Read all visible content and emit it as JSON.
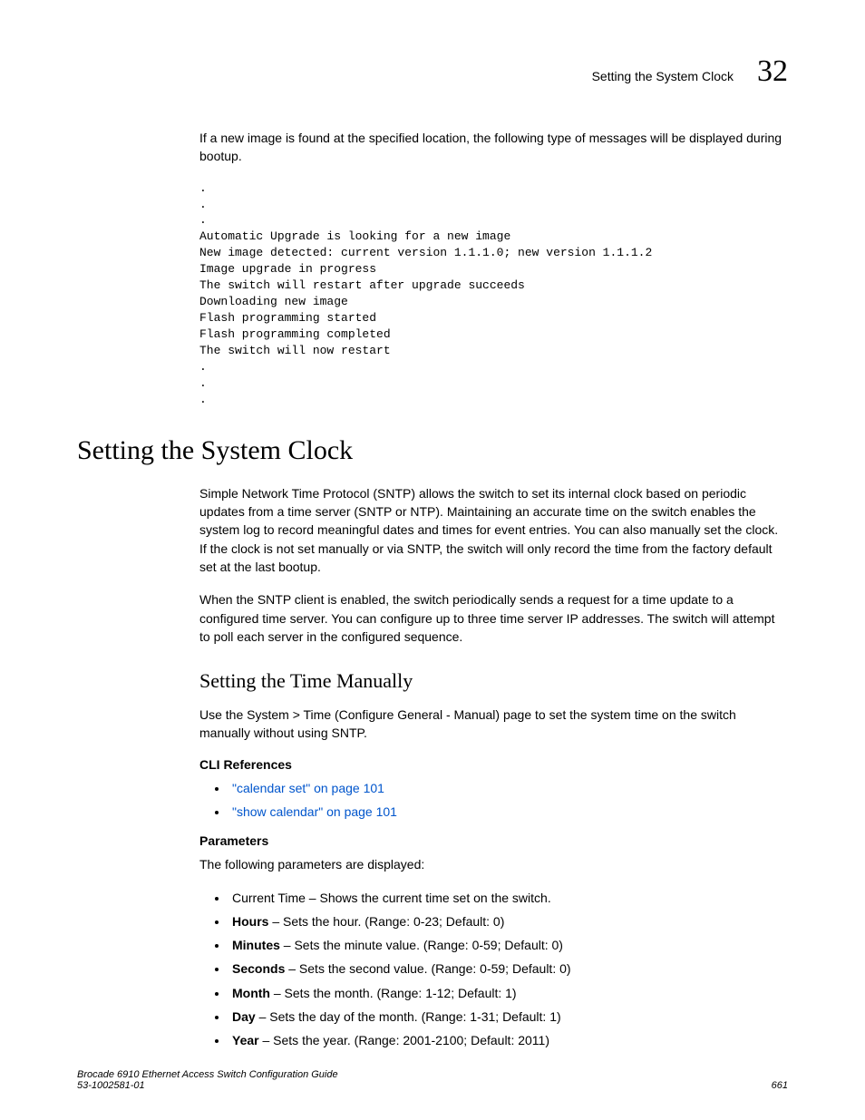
{
  "header": {
    "section": "Setting the System Clock",
    "chapter": "32"
  },
  "intro_para": "If a new image is found at the specified location, the following type of messages will be displayed during bootup.",
  "code_block": ".\n.\n.\nAutomatic Upgrade is looking for a new image\nNew image detected: current version 1.1.1.0; new version 1.1.1.2\nImage upgrade in progress\nThe switch will restart after upgrade succeeds\nDownloading new image\nFlash programming started\nFlash programming completed\nThe switch will now restart\n.\n.\n.",
  "h1": "Setting the System Clock",
  "p1": "Simple Network Time Protocol (SNTP) allows the switch to set its internal clock based on periodic updates from a time server (SNTP or NTP). Maintaining an accurate time on the switch enables the system log to record meaningful dates and times for event entries. You can also manually set the clock. If the clock is not set manually or via SNTP, the switch will only record the time from the factory default set at the last bootup.",
  "p2": "When the SNTP client is enabled, the switch periodically sends a request for a time update to a configured time server. You can configure up to three time server IP addresses. The switch will attempt to poll each server in the configured sequence.",
  "h2": "Setting the Time Manually",
  "p3": "Use the System > Time (Configure General - Manual) page to set the system time on the switch manually without using SNTP.",
  "cli_heading": "CLI References",
  "cli_links": [
    "\"calendar set\" on page 101",
    "\"show calendar\" on page 101"
  ],
  "params_heading": "Parameters",
  "params_intro": "The following parameters are displayed:",
  "params": [
    {
      "term": "",
      "desc": "Current Time – Shows the current time set on the switch."
    },
    {
      "term": "Hours",
      "desc": " – Sets the hour. (Range: 0-23; Default: 0)"
    },
    {
      "term": "Minutes",
      "desc": " – Sets the minute value. (Range: 0-59; Default: 0)"
    },
    {
      "term": "Seconds",
      "desc": " – Sets the second value. (Range: 0-59; Default: 0)"
    },
    {
      "term": "Month",
      "desc": " – Sets the month. (Range: 1-12; Default: 1)"
    },
    {
      "term": "Day",
      "desc": " – Sets the day of the month. (Range: 1-31; Default: 1)"
    },
    {
      "term": "Year",
      "desc": " – Sets the year. (Range: 2001-2100; Default: 2011)"
    }
  ],
  "footer": {
    "title": "Brocade 6910 Ethernet Access Switch Configuration Guide",
    "docnum": "53-1002581-01",
    "page": "661"
  }
}
